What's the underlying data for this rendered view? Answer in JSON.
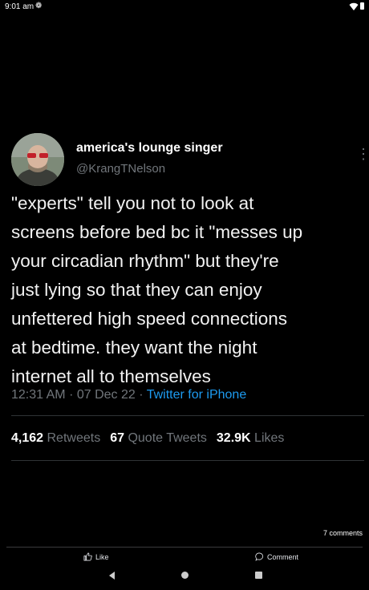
{
  "status_bar": {
    "time": "9:01 am",
    "settings_glyph": "❁"
  },
  "tweet": {
    "display_name": "america's lounge singer",
    "handle": "@KrangTNelson",
    "text": "\"experts\" tell you not to look at\nscreens before bed bc it \"messes up\nyour circadian rhythm\" but they're\njust lying so that they can enjoy\nunfettered high speed connections\nat bedtime. they want the night\ninternet all to themselves",
    "time": "12:31 AM",
    "date": "07 Dec 22",
    "separator": "·",
    "source": "Twitter for iPhone",
    "retweets_count": "4,162",
    "retweets_label": "Retweets",
    "quotes_count": "67",
    "quotes_label": "Quote Tweets",
    "likes_count": "32.9K",
    "likes_label": "Likes",
    "more_glyph": "⋮"
  },
  "post_footer": {
    "comments_count": "7 comments",
    "like_label": "Like",
    "comment_label": "Comment"
  },
  "colors": {
    "accent": "#1d9bf0",
    "muted": "#71767b",
    "background": "#000000"
  },
  "icons": [
    "settings-icon",
    "wifi-icon",
    "battery-icon",
    "more-icon",
    "like-icon",
    "comment-icon",
    "back-icon",
    "home-icon",
    "recents-icon"
  ]
}
